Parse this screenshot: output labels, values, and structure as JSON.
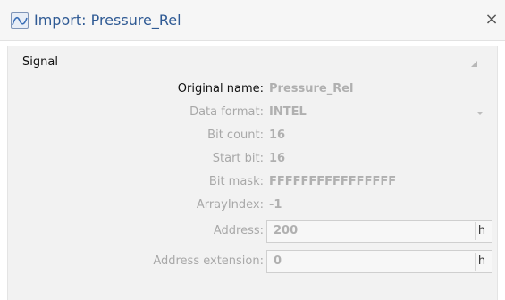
{
  "window": {
    "title": "Import: Pressure_Rel",
    "close_glyph": "×"
  },
  "section": {
    "title": "Signal"
  },
  "fields": {
    "original_name": {
      "label": "Original name:",
      "value": "Pressure_Rel"
    },
    "data_format": {
      "label": "Data format:",
      "value": "INTEL"
    },
    "bit_count": {
      "label": "Bit count:",
      "value": "16"
    },
    "start_bit": {
      "label": "Start bit:",
      "value": "16"
    },
    "bit_mask": {
      "label": "Bit mask:",
      "value": "FFFFFFFFFFFFFFFF"
    },
    "array_index": {
      "label": "ArrayIndex:",
      "value": "-1"
    },
    "address": {
      "label": "Address:",
      "value": "200",
      "unit": "h"
    },
    "address_extension": {
      "label": "Address extension:",
      "value": "0",
      "unit": "h"
    }
  },
  "icons": {
    "title_icon": "signal-waveform-icon",
    "close": "close-icon",
    "collapse": "collapse-triangle-icon",
    "dropdown": "dropdown-arrow-icon"
  },
  "colors": {
    "title_text": "#2f5a94",
    "panel_bg": "#f2f2f2",
    "disabled_text": "#a8a8a8"
  }
}
